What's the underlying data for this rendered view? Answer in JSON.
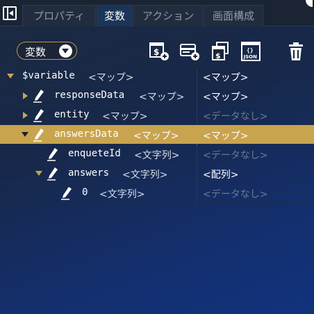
{
  "tabs": [
    {
      "label": "プロパティ",
      "active": false
    },
    {
      "label": "変数",
      "active": true
    },
    {
      "label": "アクション",
      "active": false
    },
    {
      "label": "画面構成",
      "active": false
    }
  ],
  "toolbar": {
    "dropdown_label": "変数",
    "icons": [
      "add-variable-icon",
      "add-list-icon",
      "copy-variable-icon",
      "json-icon",
      "trash-icon"
    ],
    "json_text": "JSON"
  },
  "tree": [
    {
      "name": "$variable",
      "type": "<マップ>",
      "value": "<マップ>",
      "expanded": true,
      "level": 0
    },
    {
      "name": "responseData",
      "type": "<マップ>",
      "value": "<マップ>",
      "expanded": false,
      "level": 1
    },
    {
      "name": "entity",
      "type": "<マップ>",
      "value": "<データなし>",
      "expanded": false,
      "level": 1
    },
    {
      "name": "answersData",
      "type": "<マップ>",
      "value": "<マップ>",
      "expanded": true,
      "level": 1,
      "selected": true
    },
    {
      "name": "enqueteId",
      "type": "<文字列>",
      "value": "<データなし>",
      "level": 2
    },
    {
      "name": "answers",
      "type": "<文字列>",
      "value": "<配列>",
      "expanded": true,
      "level": 2
    },
    {
      "name": "0",
      "type": "<文字列>",
      "value": "<データなし>",
      "level": 3
    }
  ],
  "colors": {
    "accent": "#c9a44e",
    "selected_row": "#c9a44e",
    "empty_value": "#6b7a92"
  }
}
